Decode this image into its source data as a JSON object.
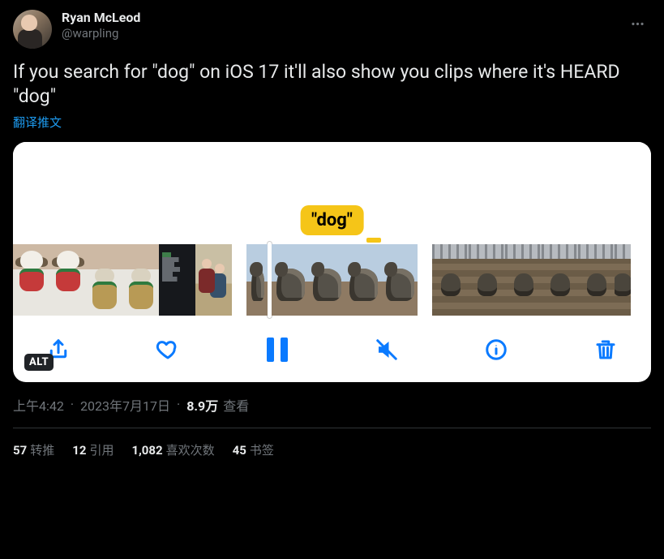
{
  "author": {
    "display_name": "Ryan McLeod",
    "handle": "@warpling"
  },
  "tweet_text": "If you search for \"dog\" on iOS 17 it'll also show you clips where it's HEARD \"dog\"",
  "translate_label": "翻译推文",
  "media": {
    "caption_bubble": "\"dog\"",
    "alt_badge": "ALT"
  },
  "meta": {
    "time": "上午4:42",
    "date": "2023年7月17日",
    "views_count": "8.9万",
    "views_label": "查看"
  },
  "stats": {
    "retweets": {
      "count": "57",
      "label": "转推"
    },
    "quotes": {
      "count": "12",
      "label": "引用"
    },
    "likes": {
      "count": "1,082",
      "label": "喜欢次数"
    },
    "bookmarks": {
      "count": "45",
      "label": "书签"
    }
  }
}
